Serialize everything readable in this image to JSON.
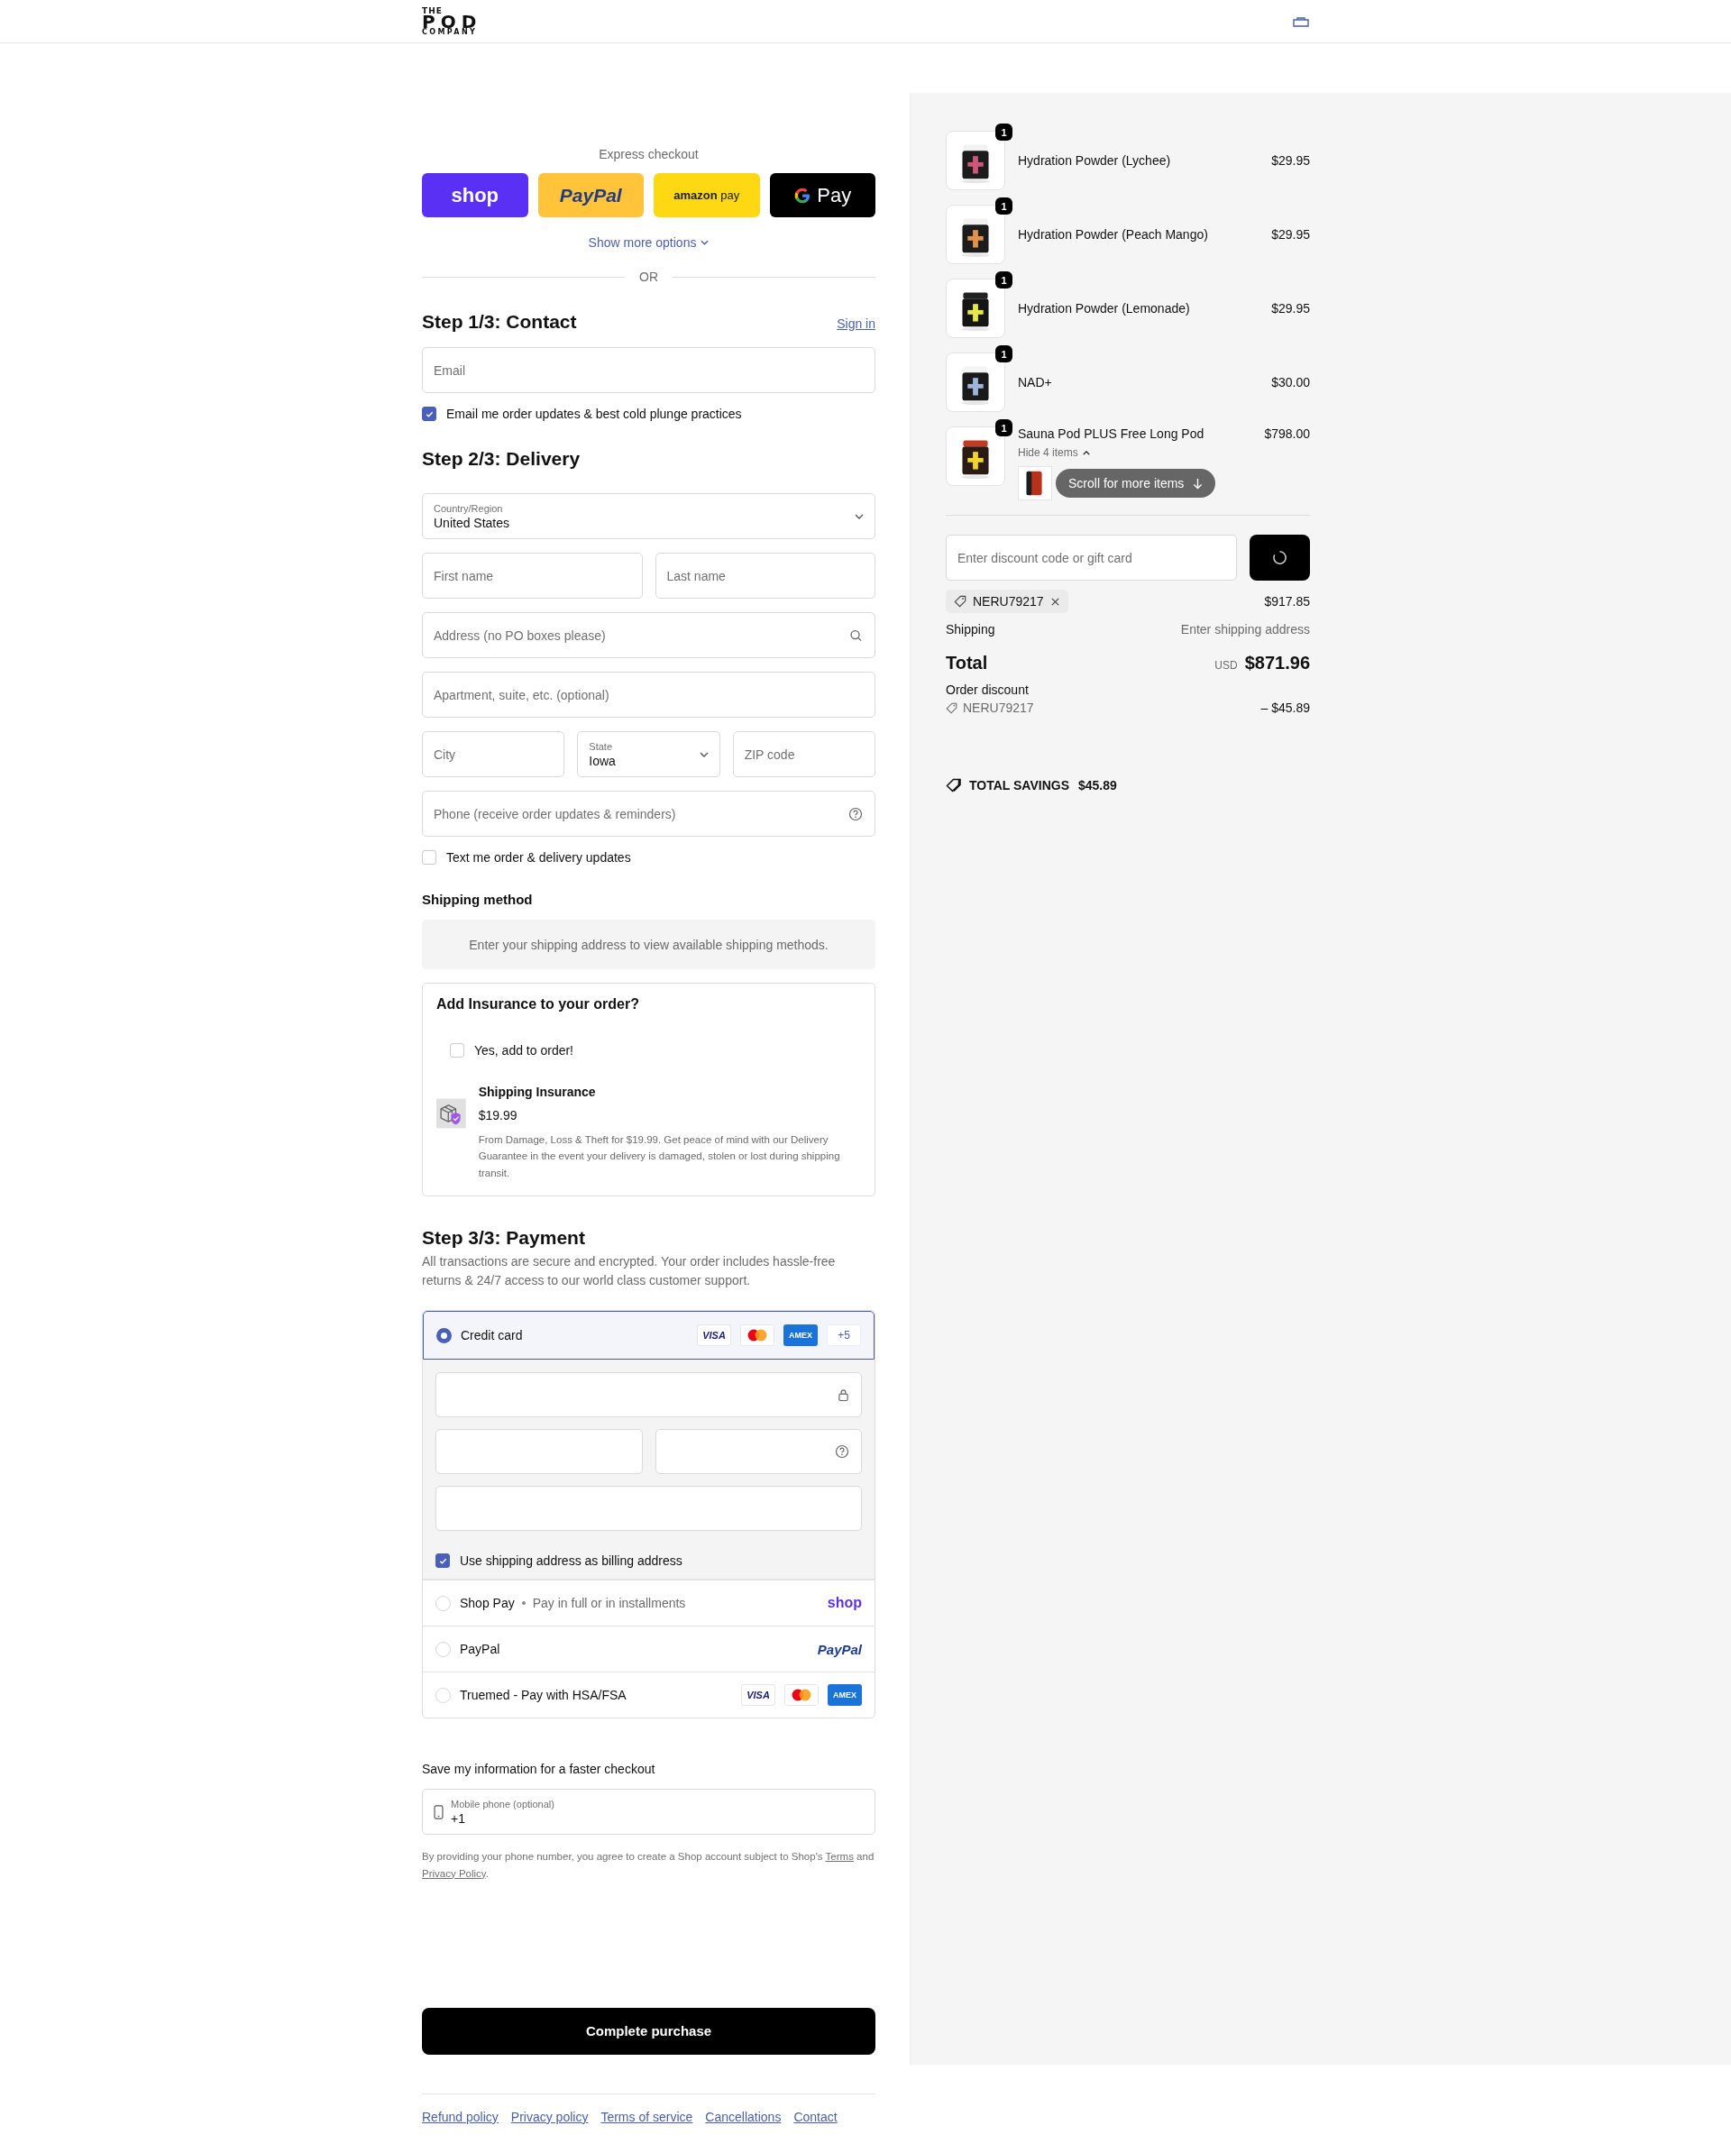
{
  "header": {
    "logo": [
      "THE",
      "POD",
      "COMPANY"
    ]
  },
  "express": {
    "title": "Express checkout",
    "buttons": [
      {
        "kind": "shop",
        "label": "shop"
      },
      {
        "kind": "paypal",
        "label": "PayPal"
      },
      {
        "kind": "amazon",
        "label": "**amazon** pay"
      },
      {
        "kind": "gpay",
        "label": "Pay"
      }
    ],
    "show_more": "Show more options",
    "divider": "OR"
  },
  "contact": {
    "heading": "Step 1/3: Contact",
    "sign_in": "Sign in",
    "email": {
      "placeholder": "Email"
    },
    "marketing": {
      "label": "Email me order updates & best cold plunge practices",
      "checked": true
    }
  },
  "delivery": {
    "heading": "Step 2/3: Delivery",
    "country": {
      "label": "Country/Region",
      "value": "United States"
    },
    "first_name": {
      "placeholder": "First name"
    },
    "last_name": {
      "placeholder": "Last name"
    },
    "address": {
      "placeholder": "Address (no PO boxes please)"
    },
    "apartment": {
      "placeholder": "Apartment, suite, etc. (optional)"
    },
    "city": {
      "placeholder": "City"
    },
    "state": {
      "label": "State",
      "value": "Iowa"
    },
    "zip": {
      "placeholder": "ZIP code"
    },
    "phone": {
      "placeholder": "Phone (receive order updates & reminders)"
    },
    "sms": {
      "label": "Text me order & delivery updates",
      "checked": false
    }
  },
  "shipping_method": {
    "heading": "Shipping method",
    "message": "Enter your shipping address to view available shipping methods."
  },
  "insurance": {
    "heading": "Add Insurance to your order?",
    "option": {
      "label": "Yes, add to order!",
      "checked": false
    },
    "product": {
      "name": "Shipping Insurance",
      "price": "$19.99",
      "description": "From Damage, Loss & Theft for $19.99. Get peace of mind with our Delivery Guarantee in the event your delivery is damaged, stolen or lost during shipping transit."
    }
  },
  "payment": {
    "heading": "Step 3/3: Payment",
    "description": "All transactions are secure and encrypted. Your order includes hassle-free returns & 24/7 access to our world class customer support.",
    "methods": [
      {
        "kind": "card",
        "label": "Credit card",
        "selected": true,
        "brands": [
          {
            "kind": "visa",
            "label": "VISA"
          },
          {
            "kind": "mastercard"
          },
          {
            "kind": "amex",
            "label": "AMEX"
          },
          {
            "kind": "more",
            "label": "+5"
          }
        ]
      },
      {
        "kind": "shoppay",
        "label": "Shop Pay",
        "subtitle": "Pay in full or in installments",
        "logo": "shop",
        "selected": false
      },
      {
        "kind": "paypal",
        "label": "PayPal",
        "logo": "PayPal",
        "selected": false
      },
      {
        "kind": "truemed",
        "label": "Truemed - Pay with HSA/FSA",
        "selected": false,
        "brands": [
          {
            "kind": "visa",
            "label": "VISA"
          },
          {
            "kind": "mastercard"
          },
          {
            "kind": "amex",
            "label": "AMEX"
          }
        ]
      }
    ],
    "billing": {
      "label": "Use shipping address as billing address",
      "checked": true
    }
  },
  "save": {
    "heading": "Save my information for a faster checkout",
    "phone": {
      "label": "Mobile phone (optional)",
      "value": "+1"
    },
    "legal": [
      {
        "kind": "text",
        "text": "By providing your phone number, you agree to create a Shop account subject to Shop's "
      },
      {
        "kind": "link",
        "text": "Terms"
      },
      {
        "kind": "text",
        "text": " and "
      },
      {
        "kind": "link",
        "text": "Privacy Policy"
      },
      {
        "kind": "text",
        "text": "."
      }
    ]
  },
  "complete": "Complete purchase",
  "footer": [
    "Refund policy",
    "Privacy policy",
    "Terms of service",
    "Cancellations",
    "Contact"
  ],
  "summary": {
    "items": [
      {
        "name": "Hydration Powder (Lychee)",
        "price": "$29.95",
        "quantity": "1"
      },
      {
        "name": "Hydration Powder (Peach Mango)",
        "price": "$29.95",
        "quantity": "1"
      },
      {
        "name": "Hydration Powder (Lemonade)",
        "price": "$29.95",
        "quantity": "1"
      },
      {
        "name": "NAD+",
        "price": "$30.00",
        "quantity": "1"
      },
      {
        "name": "Sauna Pod PLUS Free Long Pod",
        "price": "$798.00",
        "quantity": "1",
        "toggle": "Hide 4 items",
        "scroll_hint": "Scroll for more items"
      }
    ],
    "discount": {
      "placeholder": "Enter discount code or gift card"
    },
    "code": "NERU79217",
    "subtotal": "$917.85",
    "shipping": {
      "label": "Shipping",
      "value": "Enter shipping address"
    },
    "total": {
      "label": "Total",
      "currency": "USD",
      "amount": "$871.96"
    },
    "order_discount": {
      "label": "Order discount",
      "code": "NERU79217",
      "amount": "– $45.89"
    },
    "savings": {
      "label": "TOTAL SAVINGS",
      "amount": "$45.89"
    }
  }
}
